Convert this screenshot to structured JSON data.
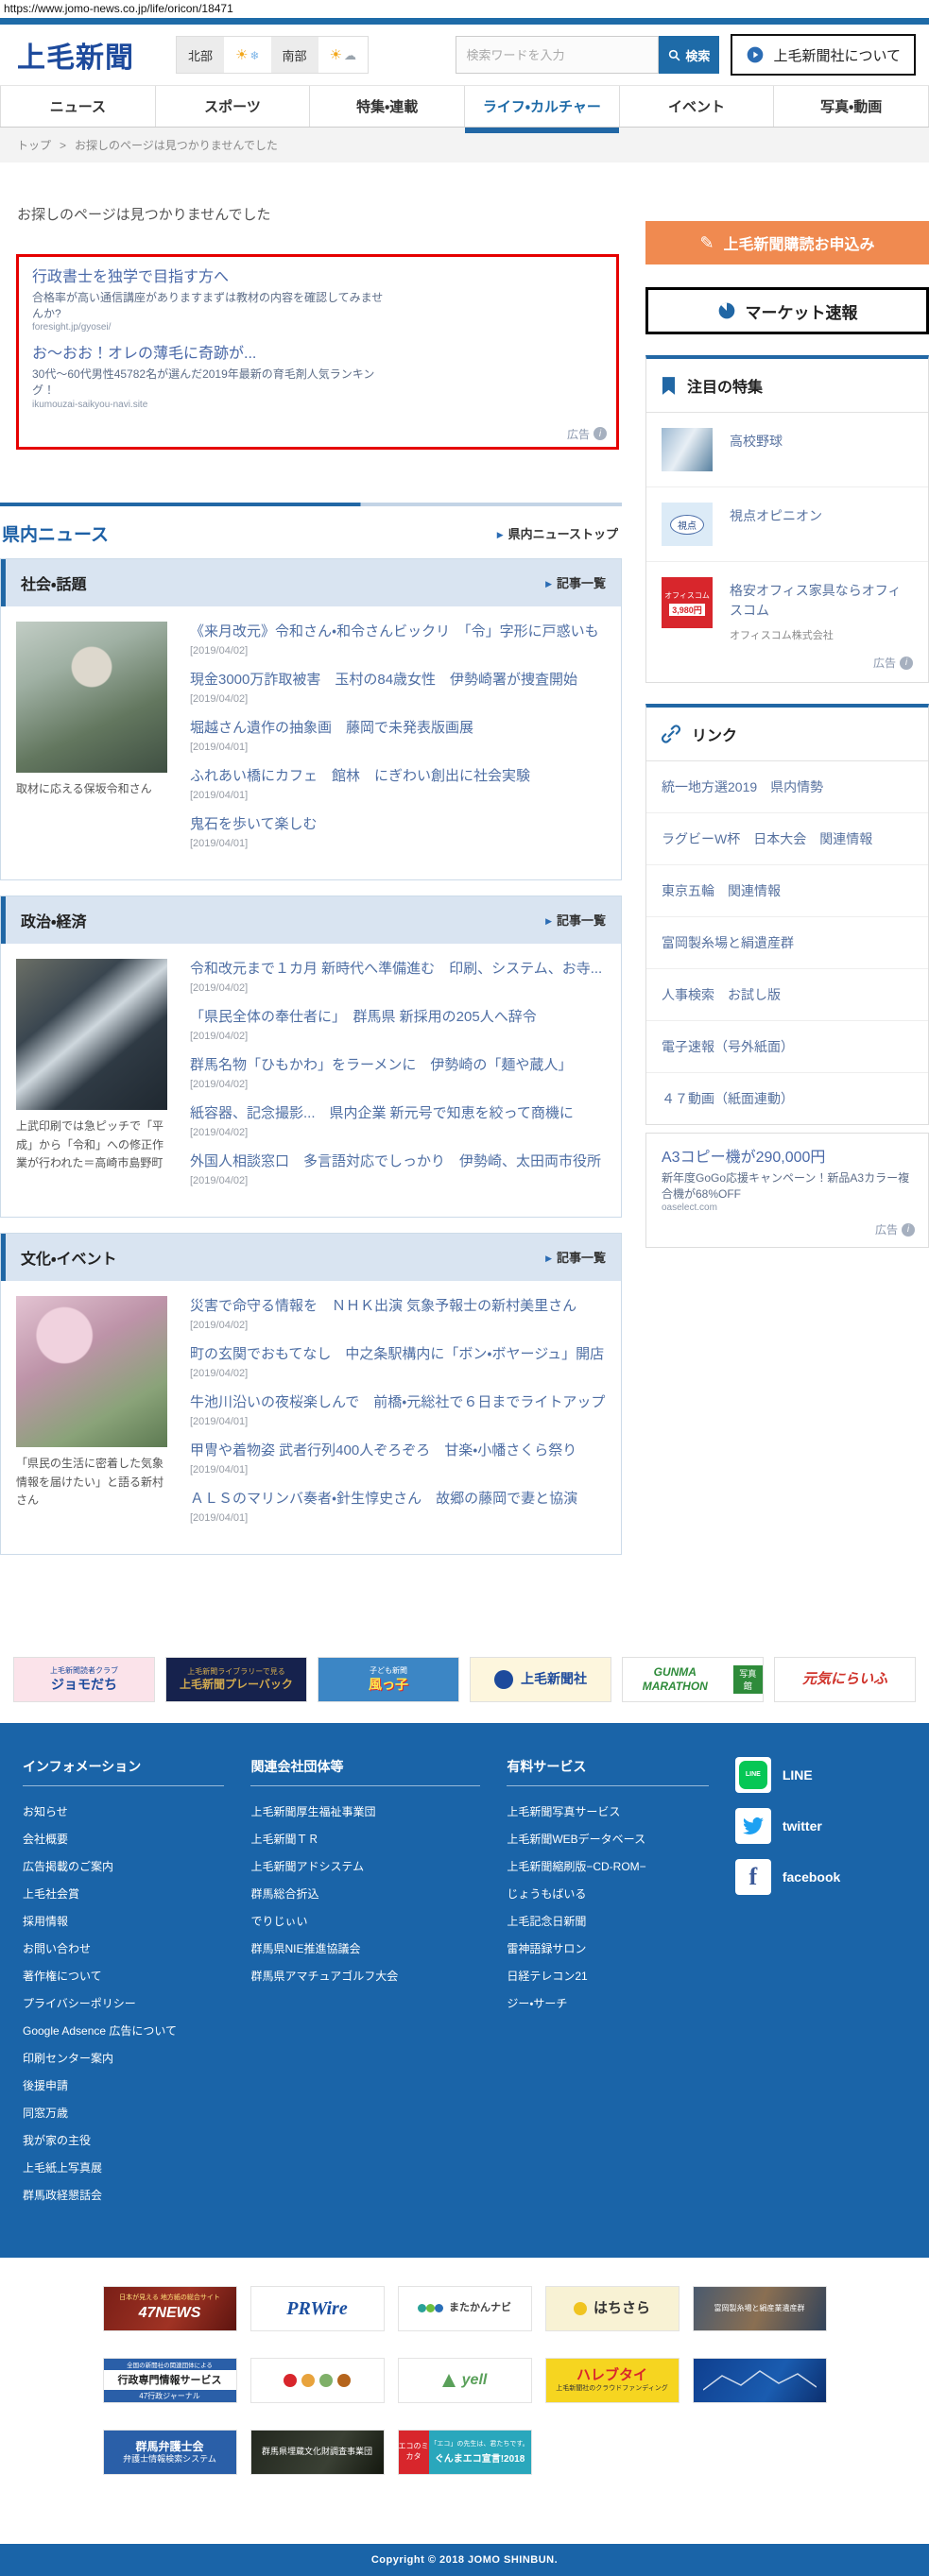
{
  "page": {
    "url": "https://www.jomo-news.co.jp/life/oricon/18471"
  },
  "header": {
    "logo": "上毛新聞",
    "weather": {
      "north_label": "北部",
      "south_label": "南部",
      "north_icons": "sun,snowflake",
      "south_icons": "sun,cloud"
    },
    "search": {
      "placeholder": "検索ワードを入力",
      "button_label": "検索"
    },
    "about_button": "上毛新聞社について"
  },
  "nav": {
    "tabs": [
      {
        "label": "ニュース",
        "active": false
      },
      {
        "label": "スポーツ",
        "active": false
      },
      {
        "label": "特集・連載",
        "active": false
      },
      {
        "label": "ライフ・カルチャー",
        "active": true
      },
      {
        "label": "イベント",
        "active": false
      },
      {
        "label": "写真・動画",
        "active": false
      }
    ]
  },
  "breadcrumb": {
    "home": "トップ",
    "sep": ">",
    "current": "お探しのページは見つかりませんでした"
  },
  "main": {
    "heading": "お探しのページは見つかりませんでした",
    "ad_box": {
      "ad_label": "広告",
      "ads": [
        {
          "title": "行政書士を独学で目指す方へ",
          "desc": "合格率が高い通信講座がありますまずは教材の内容を確認してみませんか?",
          "url": "foresight.jp/gyosei/"
        },
        {
          "title": "お〜おお！オレの薄毛に奇跡が...",
          "desc": "30代〜60代男性45782名が選んだ2019年最新の育毛剤人気ランキング！",
          "url": "ikumouzai-saikyou-navi.site"
        }
      ]
    },
    "section_title": "県内ニュース",
    "section_top_link": "県内ニューストップ",
    "sections": [
      {
        "title": "社会・話題",
        "list_link": "記事一覧",
        "caption": "取材に応える保坂令和さん",
        "articles": [
          {
            "title": "《来月改元》令和さん・和令さんビックリ　「令」字形に戸惑いも",
            "date": "[2019/04/02]"
          },
          {
            "title": "現金3000万詐取被害　玉村の84歳女性　伊勢崎署が捜査開始",
            "date": "[2019/04/02]"
          },
          {
            "title": "堀越さん遺作の抽象画　藤岡で未発表版画展",
            "date": "[2019/04/01]"
          },
          {
            "title": "ふれあい橋にカフェ　館林　にぎわい創出に社会実験",
            "date": "[2019/04/01]"
          },
          {
            "title": "鬼石を歩いて楽しむ",
            "date": "[2019/04/01]"
          }
        ]
      },
      {
        "title": "政治・経済",
        "list_link": "記事一覧",
        "caption": "上武印刷では急ピッチで「平成」から「令和」への修正作業が行われた＝高崎市島野町",
        "articles": [
          {
            "title": "令和改元まで１カ月 新時代へ準備進む　印刷、システム、お寺...",
            "date": "[2019/04/02]"
          },
          {
            "title": "「県民全体の奉仕者に」　群馬県 新採用の205人へ辞令",
            "date": "[2019/04/02]"
          },
          {
            "title": "群馬名物「ひもかわ」をラーメンに　伊勢崎の「麺や蔵人」",
            "date": "[2019/04/02]"
          },
          {
            "title": "紙容器、記念撮影...　県内企業 新元号で知恵を絞って商機に",
            "date": "[2019/04/02]"
          },
          {
            "title": "外国人相談窓口　多言語対応でしっかり　伊勢崎、太田両市役所",
            "date": "[2019/04/02]"
          }
        ]
      },
      {
        "title": "文化・イベント",
        "list_link": "記事一覧",
        "caption": "「県民の生活に密着した気象情報を届けたい」と語る新村さん",
        "articles": [
          {
            "title": "災害で命守る情報を　ＮＨＫ出演 気象予報士の新村美里さん",
            "date": "[2019/04/02]"
          },
          {
            "title": "町の玄関でおもてなし　中之条駅構内に「ボン・ボヤージュ」開店",
            "date": "[2019/04/02]"
          },
          {
            "title": "牛池川沿いの夜桜楽しんで　前橋・元総社で６日までライトアップ",
            "date": "[2019/04/01]"
          },
          {
            "title": "甲冑や着物姿 武者行列400人ぞろぞろ　甘楽・小幡さくら祭り",
            "date": "[2019/04/01]"
          },
          {
            "title": "ＡＬＳのマリンバ奏者・針生惇史さん　故郷の藤岡で妻と協演",
            "date": "[2019/04/01]"
          }
        ]
      }
    ]
  },
  "sidebar": {
    "subscribe_button": "上毛新聞購読お申込み",
    "market_button": "マーケット速報",
    "featured": {
      "title": "注目の特集",
      "items": [
        {
          "label": "高校野球"
        },
        {
          "label": "視点オピニオン",
          "thumb_text": "視点"
        }
      ],
      "ad": {
        "title": "格安オフィス家具ならオフィスコム",
        "brand": "オフィスコム株式会社",
        "thumb_title": "オフィスコム",
        "thumb_price": "3,980円",
        "ad_label": "広告"
      }
    },
    "links": {
      "title": "リンク",
      "items": [
        "統一地方選2019　県内情勢",
        "ラグビーW杯　日本大会　関連情報",
        "東京五輪　関連情報",
        "富岡製糸場と絹遺産群",
        "人事検索　お試し版",
        "電子速報（号外紙面）",
        "４７動画（紙面連動）"
      ]
    },
    "ad": {
      "title": "A3コピー機が290,000円",
      "desc": "新年度GoGo応援キャンペーン！新品A3カラー複合機が68%OFF",
      "url": "oaselect.com",
      "ad_label": "広告"
    }
  },
  "partners": [
    {
      "small": "上毛新聞読者クラブ",
      "main": "ジョモだち"
    },
    {
      "small": "上毛新聞ライブラリーで見る",
      "main": "上毛新聞プレーバック"
    },
    {
      "small": "子ども新聞",
      "main": "風っ子"
    },
    {
      "main": "上毛新聞社"
    },
    {
      "main": "GUNMA MARATHON",
      "small": "写真館"
    },
    {
      "main": "元気にらいふ"
    }
  ],
  "footer": {
    "columns": [
      {
        "title": "インフォメーション",
        "items": [
          "お知らせ",
          "会社概要",
          "広告掲載のご案内",
          "上毛社会賞",
          "採用情報",
          "お問い合わせ",
          "著作権について",
          "プライバシーポリシー",
          "Google Adsence 広告について",
          "印刷センター案内",
          "後援申請",
          "同窓万歳",
          "我が家の主役",
          "上毛紙上写真展",
          "群馬政経懇話会"
        ]
      },
      {
        "title": "関連会社団体等",
        "items": [
          "上毛新聞厚生福祉事業団",
          "上毛新聞ＴＲ",
          "上毛新聞アドシステム",
          "群馬総合折込",
          "でりじぃい",
          "群馬県NIE推進協議会",
          "群馬県アマチュアゴルフ大会"
        ]
      },
      {
        "title": "有料サービス",
        "items": [
          "上毛新聞写真サービス",
          "上毛新聞WEBデータベース",
          "上毛新聞縮刷版−CD-ROM−",
          "じょうもばいる",
          "上毛記念日新聞",
          "雷神語録サロン",
          "日経テレコン21",
          "ジー・サーチ"
        ]
      }
    ],
    "social": [
      "LINE",
      "twitter",
      "facebook"
    ],
    "copyright": "Copyright © 2018 JOMO SHINBUN."
  },
  "banners": {
    "row1": [
      {
        "title": "47NEWS",
        "sub": "日本が見える 地方紙の総合サイト"
      },
      {
        "title": "PRWire"
      },
      {
        "title": "またかんナビ"
      },
      {
        "title": "はちさら"
      },
      {
        "title": "富岡製糸場と絹産業遺産群"
      }
    ],
    "row2": [
      {
        "top": "全国の新聞社の関連団体による",
        "title": "行政専門情報サービス",
        "bottom": "47行政ジャーナル"
      },
      {
        "title": ""
      },
      {
        "title": "yell"
      },
      {
        "title": "ハレブタイ",
        "sub": "上毛新聞社のクラウドファンディング"
      },
      {
        "title": ""
      }
    ],
    "row3": [
      {
        "title": "群馬弁護士会",
        "sub": "弁護士情報検索システム"
      },
      {
        "title": "群馬県埋蔵文化財調査事業団"
      },
      {
        "tag": "エコのミカタ",
        "line1": "「エコ」の先生は、君たちです。",
        "line2": "ぐんまエコ宣言!2018"
      }
    ]
  },
  "colors": {
    "primary_blue": "#1e6ba8",
    "logo_navy": "#1d4a9c",
    "footer_blue": "#1a64a8",
    "accent_orange": "#f08a50",
    "ad_border_red": "#e60000",
    "link_blue": "#4f6fa4",
    "line_green": "#06c755",
    "twitter_blue": "#1da1f2",
    "facebook_blue": "#3b5998"
  },
  "icons": [
    "magnifier-icon",
    "play-circle-icon",
    "sun-icon",
    "snowflake-icon",
    "cloud-icon",
    "pencil-icon",
    "pie-chart-icon",
    "bookmark-icon",
    "link-icon",
    "info-icon",
    "arrow-icon",
    "line-icon",
    "twitter-icon",
    "facebook-icon"
  ]
}
